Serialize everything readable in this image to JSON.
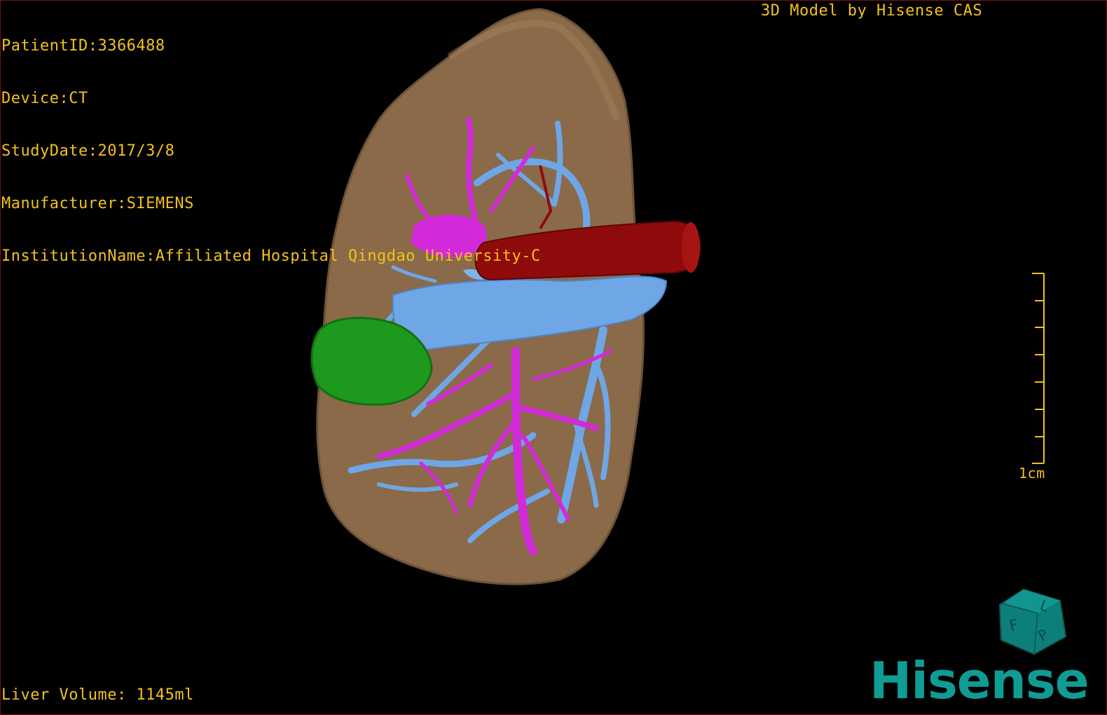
{
  "overlay": {
    "patient_id": "PatientID:3366488",
    "device": "Device:CT",
    "study_date": "StudyDate:2017/3/8",
    "manufacturer": "Manufacturer:SIEMENS",
    "institution": "InstitutionName:Affiliated Hospital Qingdao University-C",
    "title": "3D Model by Hisense CAS",
    "liver_volume": "Liver Volume: 1145ml",
    "scale_label": "1cm"
  },
  "orientation_cube": {
    "letters": [
      "F",
      "L",
      "P"
    ],
    "color": "#0d7f7a"
  },
  "brand": {
    "logo_text": "Hisense",
    "color": "#0f9c95"
  },
  "colors": {
    "text": "#f2c21a",
    "liver": "#8a6a48",
    "hepatic_vein": "#6fa6e6",
    "portal_vein": "#d22ad8",
    "ivc": "#8f0b0b",
    "lesion": "#1d9a1d",
    "frame": "#7a1010"
  }
}
